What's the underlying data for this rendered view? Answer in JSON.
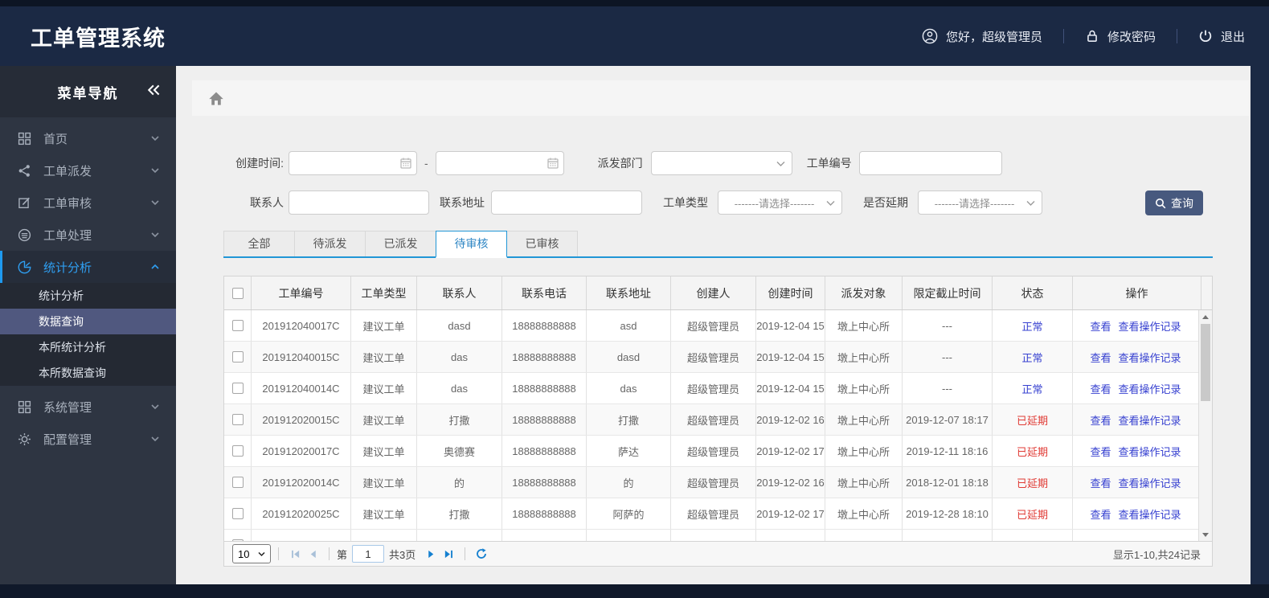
{
  "header": {
    "title": "工单管理系统",
    "greeting": "您好，超级管理员",
    "change_password": "修改密码",
    "logout": "退出"
  },
  "sidebar": {
    "title": "菜单导航",
    "items": [
      {
        "label": "首页"
      },
      {
        "label": "工单派发"
      },
      {
        "label": "工单审核"
      },
      {
        "label": "工单处理"
      },
      {
        "label": "统计分析",
        "active": true,
        "children": [
          "统计分析",
          "数据查询",
          "本所统计分析",
          "本所数据查询"
        ],
        "selected_child": "数据查询"
      },
      {
        "label": "系统管理"
      },
      {
        "label": "配置管理"
      }
    ]
  },
  "filters": {
    "create_time_label": "创建时间:",
    "date_separator": "-",
    "dispatch_dept_label": "派发部门",
    "order_no_label": "工单编号",
    "contact_label": "联系人",
    "address_label": "联系地址",
    "order_type_label": "工单类型",
    "order_type_placeholder": "-------请选择-------",
    "delay_label": "是否延期",
    "delay_placeholder": "-------请选择-------",
    "search_button": "查询"
  },
  "tabs": [
    {
      "label": "全部"
    },
    {
      "label": "待派发"
    },
    {
      "label": "已派发"
    },
    {
      "label": "待审核",
      "active": true
    },
    {
      "label": "已审核"
    }
  ],
  "table": {
    "columns": [
      "工单编号",
      "工单类型",
      "联系人",
      "联系电话",
      "联系地址",
      "创建人",
      "创建时间",
      "派发对象",
      "限定截止时间",
      "状态",
      "操作"
    ],
    "action_links": [
      "查看",
      "查看操作记录"
    ],
    "rows": [
      {
        "order_no": "201912040017C",
        "type": "建议工单",
        "contact": "dasd",
        "phone": "18888888888",
        "address": "asd",
        "creator": "超级管理员",
        "created": "2019-12-04 15",
        "target": "墩上中心所",
        "deadline": "---",
        "status": "正常",
        "status_type": "normal"
      },
      {
        "order_no": "201912040015C",
        "type": "建议工单",
        "contact": "das",
        "phone": "18888888888",
        "address": "dasd",
        "creator": "超级管理员",
        "created": "2019-12-04 15",
        "target": "墩上中心所",
        "deadline": "---",
        "status": "正常",
        "status_type": "normal"
      },
      {
        "order_no": "201912040014C",
        "type": "建议工单",
        "contact": "das",
        "phone": "18888888888",
        "address": "das",
        "creator": "超级管理员",
        "created": "2019-12-04 15",
        "target": "墩上中心所",
        "deadline": "---",
        "status": "正常",
        "status_type": "normal"
      },
      {
        "order_no": "201912020015C",
        "type": "建议工单",
        "contact": "打撒",
        "phone": "18888888888",
        "address": "打撒",
        "creator": "超级管理员",
        "created": "2019-12-02 16",
        "target": "墩上中心所",
        "deadline": "2019-12-07 18:17",
        "status": "已延期",
        "status_type": "delayed"
      },
      {
        "order_no": "201912020017C",
        "type": "建议工单",
        "contact": "奥德赛",
        "phone": "18888888888",
        "address": "萨达",
        "creator": "超级管理员",
        "created": "2019-12-02 17",
        "target": "墩上中心所",
        "deadline": "2019-12-11 18:16",
        "status": "已延期",
        "status_type": "delayed"
      },
      {
        "order_no": "201912020014C",
        "type": "建议工单",
        "contact": "的",
        "phone": "18888888888",
        "address": "的",
        "creator": "超级管理员",
        "created": "2019-12-02 16",
        "target": "墩上中心所",
        "deadline": "2018-12-01 18:18",
        "status": "已延期",
        "status_type": "delayed"
      },
      {
        "order_no": "201912020025C",
        "type": "建议工单",
        "contact": "打撒",
        "phone": "18888888888",
        "address": "阿萨的",
        "creator": "超级管理员",
        "created": "2019-12-02 17",
        "target": "墩上中心所",
        "deadline": "2019-12-28 18:10",
        "status": "已延期",
        "status_type": "delayed"
      }
    ]
  },
  "pagination": {
    "page_size": "10",
    "page_prefix": "第",
    "current_page": "1",
    "total_pages": "共3页",
    "summary": "显示1-10,共24记录"
  },
  "colors": {
    "header_bg": "#1b2944",
    "sidebar_bg": "#2e3542",
    "sidebar_selected": "#50587f",
    "accent_blue": "#1e9af0",
    "tab_active_border": "#2196d6",
    "link_blue": "#3640d0",
    "status_normal": "#3640d0",
    "status_delayed": "#e03a34",
    "query_button_bg": "#47597e"
  }
}
